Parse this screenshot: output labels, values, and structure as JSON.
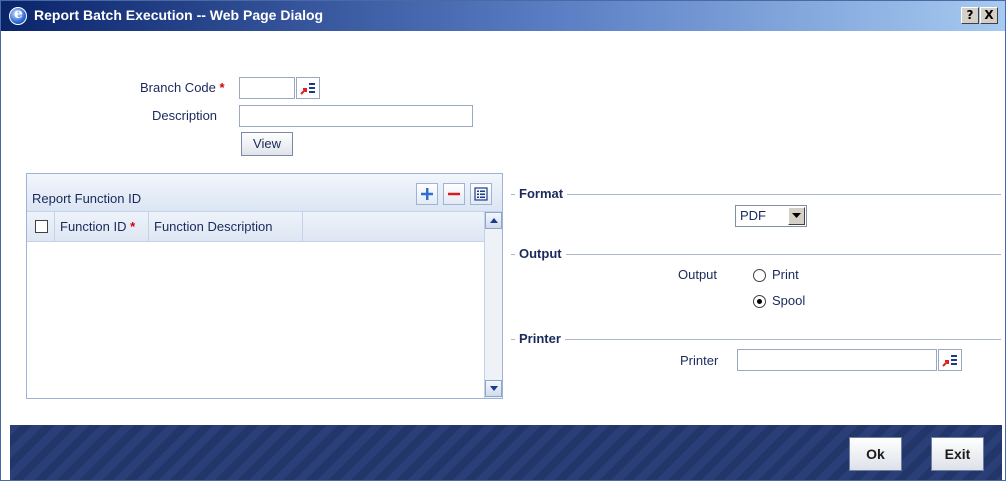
{
  "window": {
    "title": "Report Batch Execution -- Web Page Dialog",
    "help_label": "?",
    "close_label": "X"
  },
  "branch": {
    "label": "Branch Code",
    "required_mark": "*",
    "value": ""
  },
  "description": {
    "label": "Description",
    "value": ""
  },
  "view_button": "View",
  "grid": {
    "title": "Report Function ID",
    "columns": [
      "Function ID",
      "Function Description"
    ],
    "required_mark": "*",
    "rows": []
  },
  "format": {
    "section_title": "Format",
    "selected": "PDF"
  },
  "output": {
    "section_title": "Output",
    "label": "Output",
    "options": [
      "Print",
      "Spool"
    ],
    "selected": "Spool"
  },
  "printer": {
    "section_title": "Printer",
    "label": "Printer",
    "value": ""
  },
  "footer": {
    "ok_label": "Ok",
    "exit_label": "Exit"
  },
  "icons": {
    "title": "ie-icon",
    "lov": "lov-list-icon",
    "add": "plus-icon",
    "delete": "minus-icon",
    "view": "list-view-icon"
  }
}
